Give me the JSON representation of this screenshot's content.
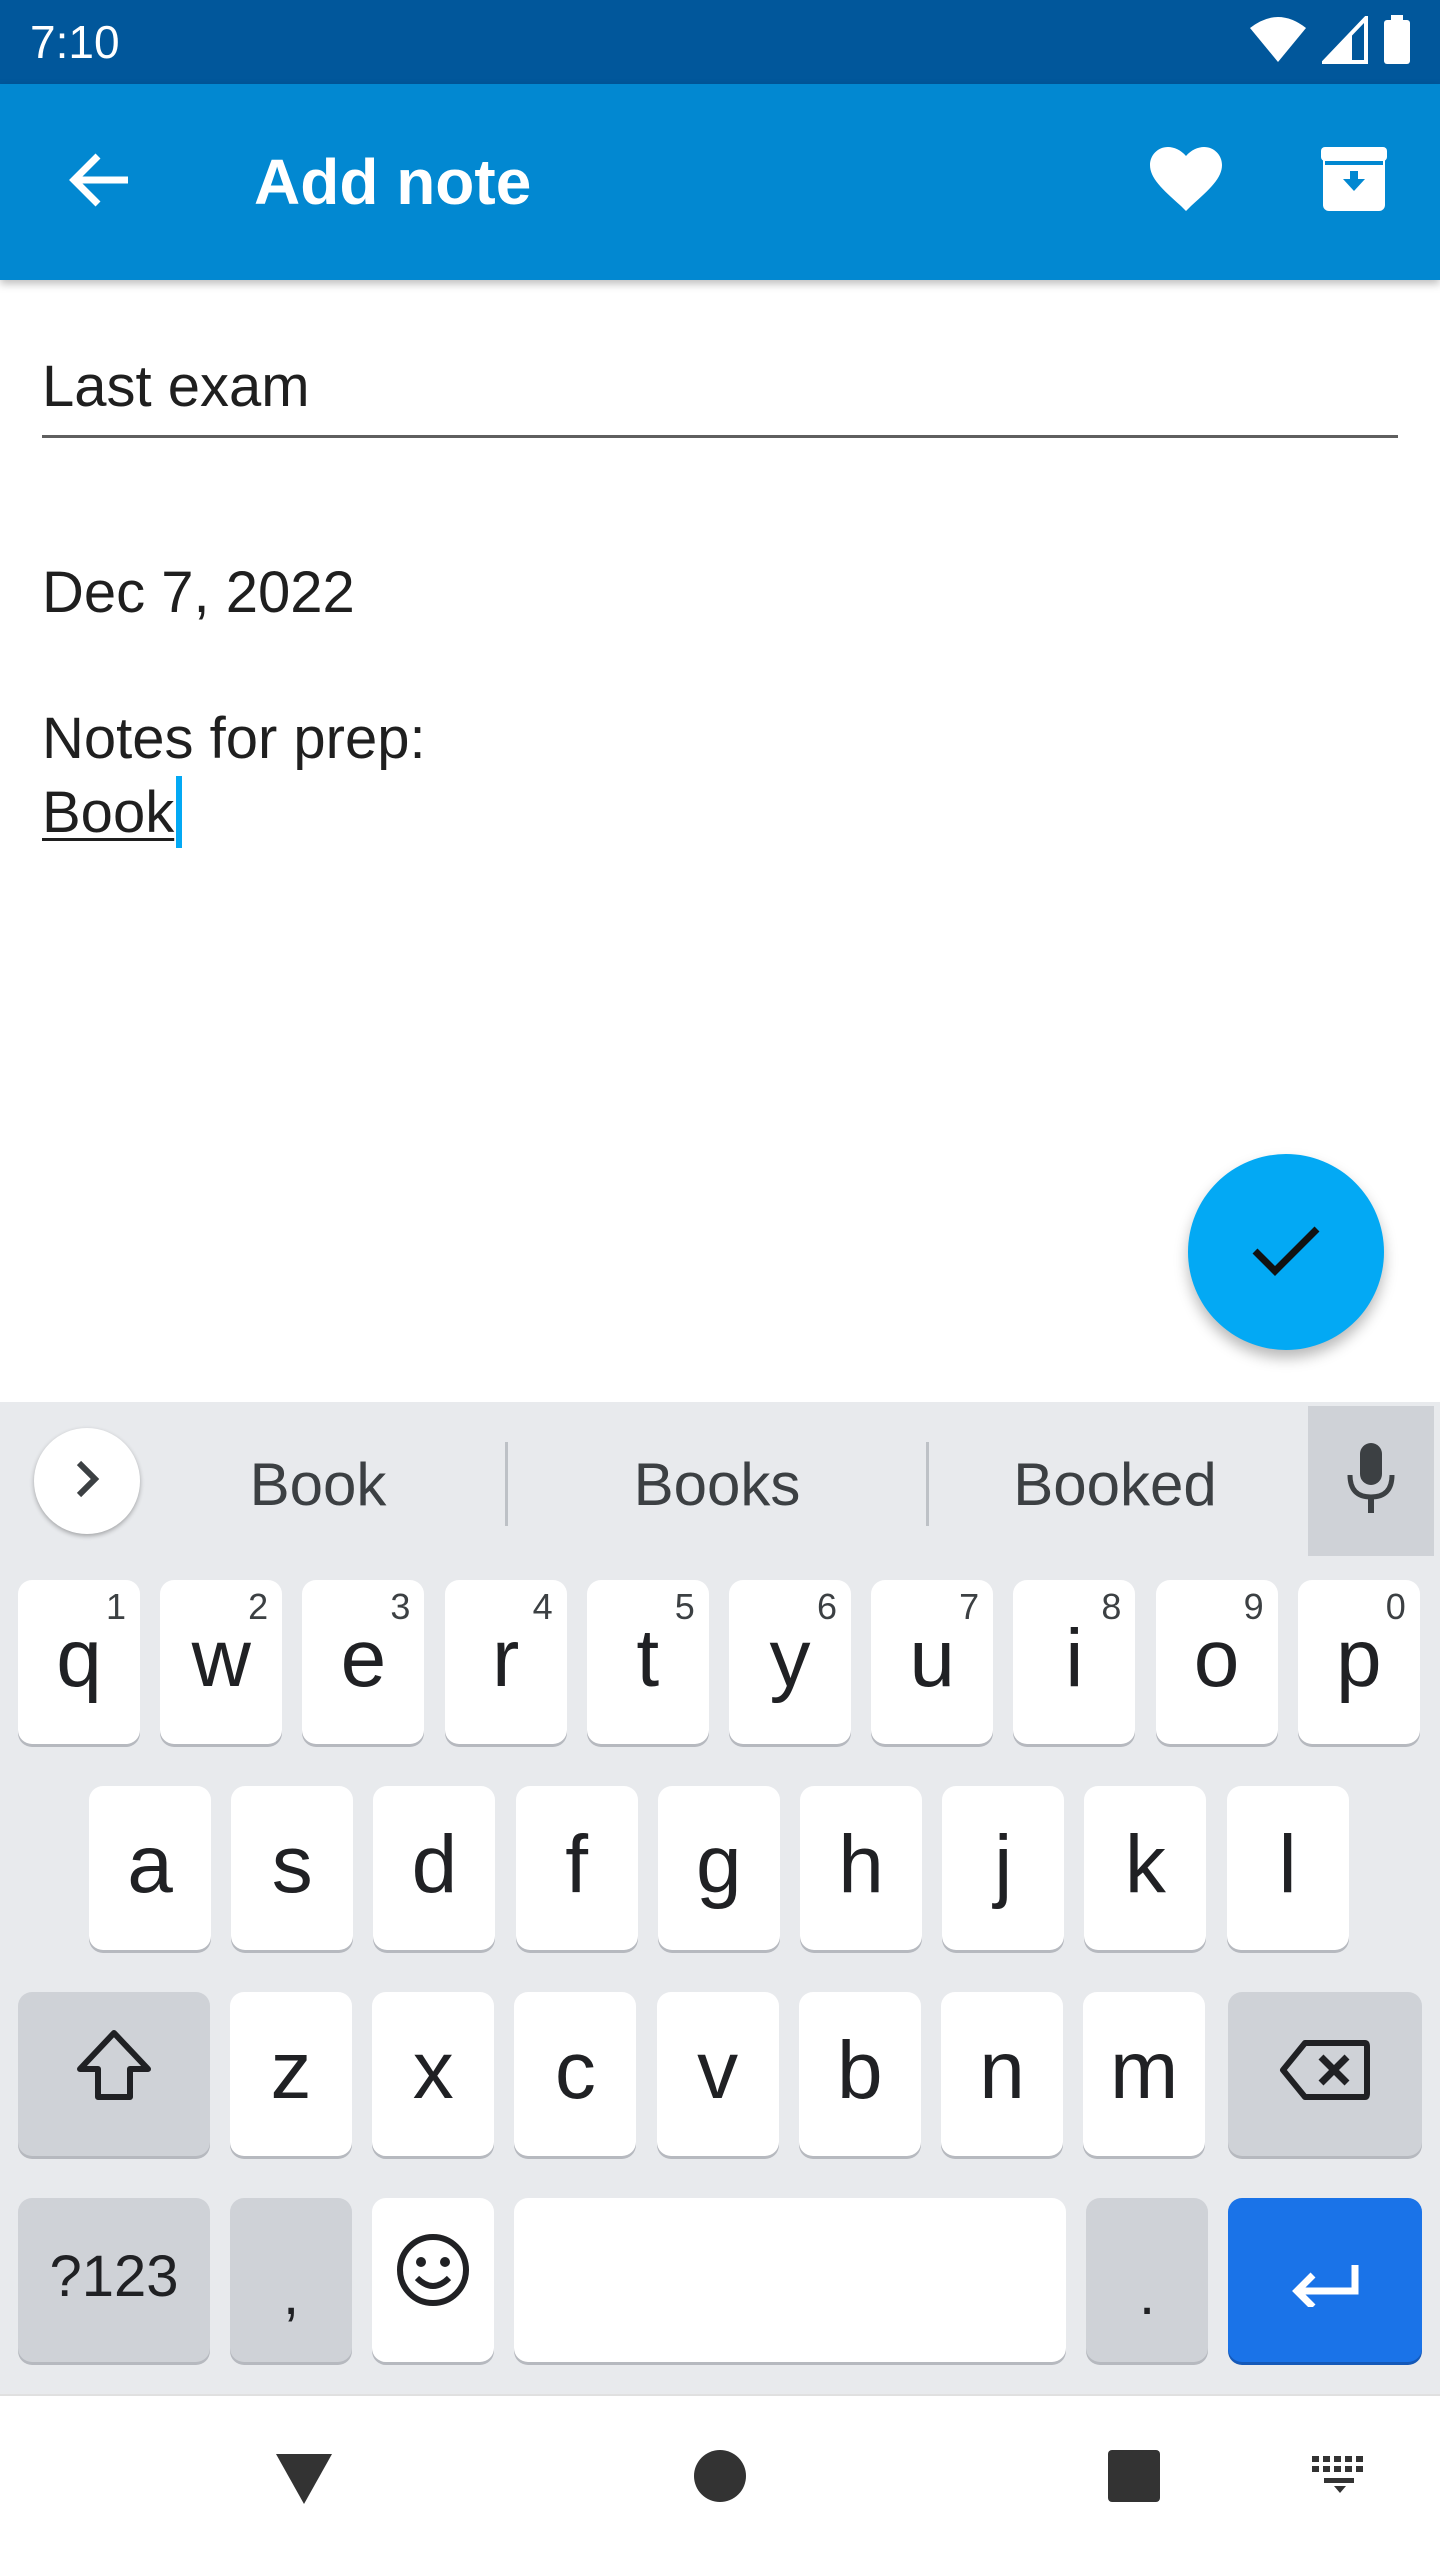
{
  "status_bar": {
    "time": "7:10",
    "icons": [
      "wifi-icon",
      "cell-signal-icon",
      "battery-icon"
    ],
    "color": "#01579b"
  },
  "app_bar": {
    "title": "Add note",
    "back_icon": "arrow-back-icon",
    "actions": [
      "favorite-heart-icon",
      "archive-icon"
    ],
    "color": "#0288d1"
  },
  "note": {
    "title_value": "Last exam",
    "body_lines": [
      "Dec 7, 2022",
      "",
      "Notes for prep:"
    ],
    "composing_word": "Book"
  },
  "fab": {
    "icon": "check-icon",
    "color": "#03a9f4"
  },
  "keyboard": {
    "suggestions": [
      "Book",
      "Books",
      "Booked"
    ],
    "expand_icon": "chevron-right-icon",
    "mic_icon": "microphone-icon",
    "row1": [
      {
        "key": "q",
        "hint": "1"
      },
      {
        "key": "w",
        "hint": "2"
      },
      {
        "key": "e",
        "hint": "3"
      },
      {
        "key": "r",
        "hint": "4"
      },
      {
        "key": "t",
        "hint": "5"
      },
      {
        "key": "y",
        "hint": "6"
      },
      {
        "key": "u",
        "hint": "7"
      },
      {
        "key": "i",
        "hint": "8"
      },
      {
        "key": "o",
        "hint": "9"
      },
      {
        "key": "p",
        "hint": "0"
      }
    ],
    "row2": [
      "a",
      "s",
      "d",
      "f",
      "g",
      "h",
      "j",
      "k",
      "l"
    ],
    "row3": [
      "z",
      "x",
      "c",
      "v",
      "b",
      "n",
      "m"
    ],
    "symbols_label": "?123",
    "comma": ",",
    "period": ".",
    "shift_icon": "shift-icon",
    "backspace_icon": "backspace-icon",
    "emoji_icon": "emoji-icon",
    "enter_icon": "enter-icon",
    "enter_color": "#1a73e8"
  },
  "nav_bar": {
    "icons": [
      "nav-back-icon",
      "nav-home-icon",
      "nav-recents-icon",
      "keyboard-switch-icon"
    ]
  }
}
